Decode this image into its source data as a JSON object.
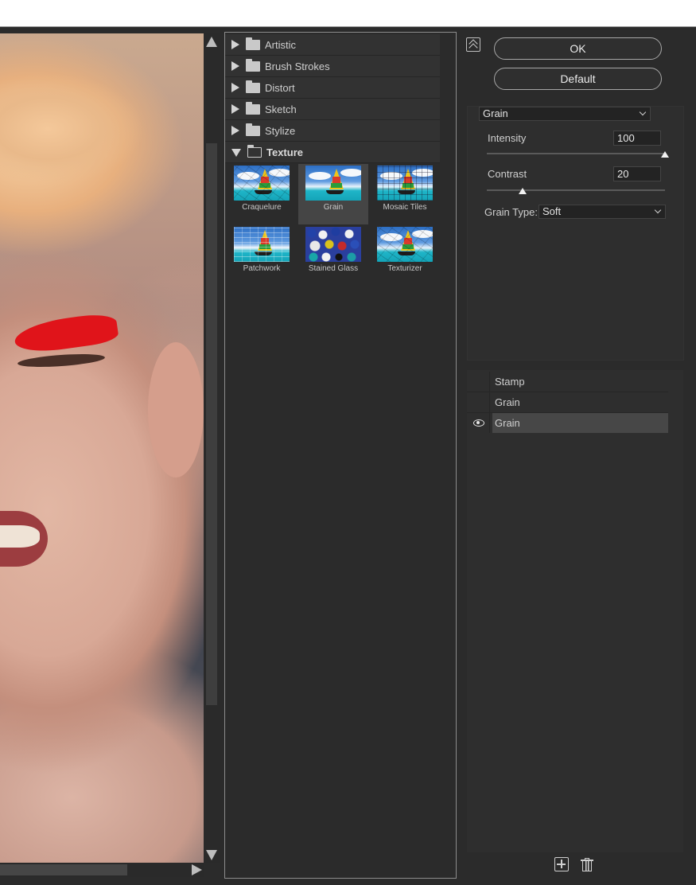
{
  "categories": [
    {
      "label": "Artistic",
      "expanded": false
    },
    {
      "label": "Brush Strokes",
      "expanded": false
    },
    {
      "label": "Distort",
      "expanded": false
    },
    {
      "label": "Sketch",
      "expanded": false
    },
    {
      "label": "Stylize",
      "expanded": false
    },
    {
      "label": "Texture",
      "expanded": true
    }
  ],
  "texture_filters": [
    {
      "label": "Craquelure"
    },
    {
      "label": "Grain",
      "selected": true
    },
    {
      "label": "Mosaic Tiles"
    },
    {
      "label": "Patchwork"
    },
    {
      "label": "Stained Glass"
    },
    {
      "label": "Texturizer"
    }
  ],
  "buttons": {
    "ok": "OK",
    "default": "Default"
  },
  "settings": {
    "filter_select": "Grain",
    "intensity": {
      "label": "Intensity",
      "value": "100",
      "level": 1.0
    },
    "contrast": {
      "label": "Contrast",
      "value": "20",
      "level": 0.2
    },
    "grain_type": {
      "label": "Grain Type:",
      "value": "Soft"
    }
  },
  "layers": [
    {
      "name": "Stamp",
      "visible": false
    },
    {
      "name": "Grain",
      "visible": false
    },
    {
      "name": "Grain",
      "visible": true,
      "active": true
    }
  ],
  "icons": {
    "collapse": "double-chevron-up-icon",
    "eye": "eye-icon",
    "add": "new-layer-icon",
    "delete": "trash-icon",
    "folder": "folder-icon"
  },
  "colors": {
    "background": "#2b2b2b",
    "panel": "#2e2e2e",
    "selection": "#474747"
  }
}
